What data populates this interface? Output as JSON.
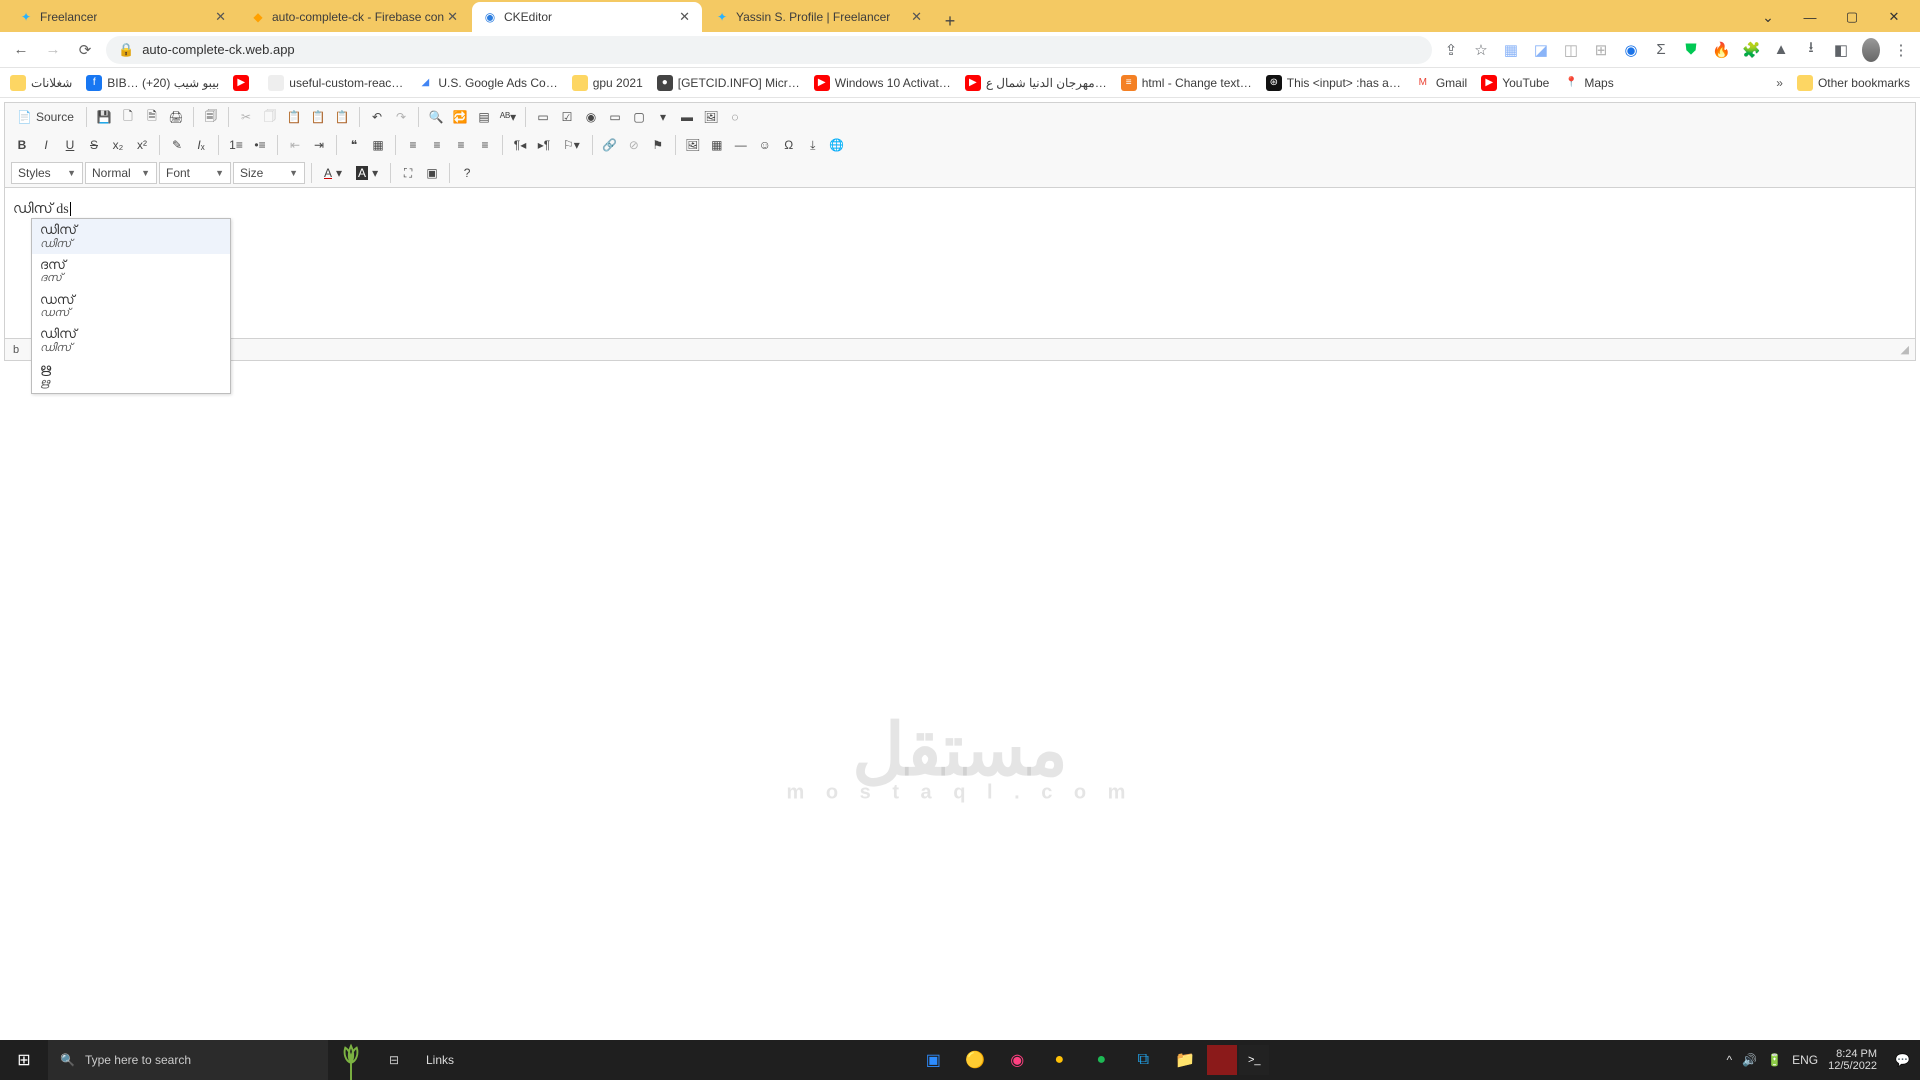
{
  "browser": {
    "tabs": [
      {
        "title": "Freelancer",
        "fav_color": "#29b2fe",
        "fav_text": "✦"
      },
      {
        "title": "auto-complete-ck - Firebase con",
        "fav_color": "#ffa000",
        "fav_text": "◆"
      },
      {
        "title": "CKEditor",
        "fav_color": "#2b7de0",
        "fav_text": "◉"
      },
      {
        "title": "Yassin S. Profile | Freelancer",
        "fav_color": "#29b2fe",
        "fav_text": "✦"
      }
    ],
    "active_tab_index": 2,
    "url": "auto-complete-ck.web.app",
    "window_controls": {
      "min": "—",
      "max": "▢",
      "close": "✕",
      "chev": "⌄"
    }
  },
  "bookmarks": [
    {
      "label": "شغلانات",
      "icon_bg": "#fdd663",
      "icon_txt": ""
    },
    {
      "label": "BIB… بيبو شيب (20+)",
      "icon_bg": "#1877f2",
      "icon_txt": "f"
    },
    {
      "label": "",
      "icon_bg": "#ff0000",
      "icon_txt": "▶"
    },
    {
      "label": "useful-custom-reac…",
      "icon_bg": "#eee",
      "icon_txt": ""
    },
    {
      "label": "U.S. Google Ads Co…",
      "icon_bg": "#fff",
      "icon_txt": "◢"
    },
    {
      "label": "gpu 2021",
      "icon_bg": "#fdd663",
      "icon_txt": ""
    },
    {
      "label": "[GETCID.INFO] Micr…",
      "icon_bg": "#444",
      "icon_txt": "●"
    },
    {
      "label": "Windows 10 Activat…",
      "icon_bg": "#ff0000",
      "icon_txt": "▶"
    },
    {
      "label": "مهرجان الدنيا شمال ع…",
      "icon_bg": "#ff0000",
      "icon_txt": "▶"
    },
    {
      "label": "html - Change text…",
      "icon_bg": "#f48024",
      "icon_txt": "≡"
    },
    {
      "label": "This <input> :has a…",
      "icon_bg": "#111",
      "icon_txt": "⊛"
    },
    {
      "label": "Gmail",
      "icon_bg": "#fff",
      "icon_txt": "M"
    },
    {
      "label": "YouTube",
      "icon_bg": "#ff0000",
      "icon_txt": "▶"
    },
    {
      "label": "Maps",
      "icon_bg": "#fff",
      "icon_txt": "📍"
    }
  ],
  "bookmarks_tail": {
    "overflow": "»",
    "other": "Other bookmarks"
  },
  "ck": {
    "source": "Source",
    "dropdowns": {
      "styles": "Styles",
      "format": "Normal",
      "font": "Font",
      "size": "Size"
    },
    "status_path": "b",
    "content_text": "ഡിസ്   ds",
    "autocomplete": [
      {
        "main": "ഡിസ്",
        "sub": "ഡിസ്"
      },
      {
        "main": "ദസ്",
        "sub": "ദസ്"
      },
      {
        "main": "ഡസ്",
        "sub": "ഡസ്"
      },
      {
        "main": "ഡിസ്",
        "sub": "ഡിസ്"
      },
      {
        "main": "ഋ",
        "sub": "ഋ"
      }
    ]
  },
  "watermark": {
    "main": "مستقل",
    "sub": "m o s t a q l . c o m"
  },
  "taskbar": {
    "search_placeholder": "Type here to search",
    "links_label": "Links",
    "tray_lang": "ENG",
    "time": "8:24 PM",
    "date": "12/5/2022"
  }
}
